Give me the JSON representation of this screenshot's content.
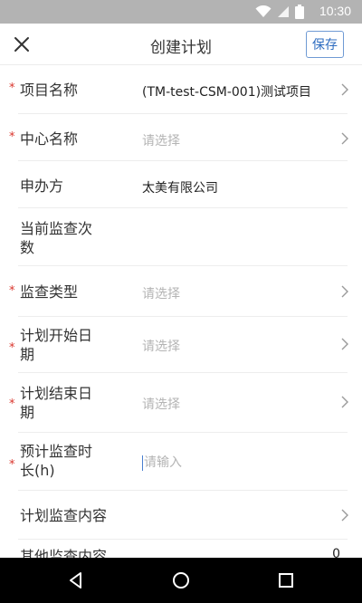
{
  "status_bar": {
    "time": "10:30",
    "icons": [
      "wifi-icon",
      "signal-icon",
      "battery-icon"
    ]
  },
  "app_bar": {
    "title": "创建计划",
    "save_label": "保存",
    "close_icon": "close-icon"
  },
  "form": {
    "rows": [
      {
        "label": "项目名称",
        "required": true,
        "value": "(TM-test-CSM-001)测试项目",
        "placeholder": "",
        "chevron": true
      },
      {
        "label": "中心名称",
        "required": true,
        "value": "",
        "placeholder": "请选择",
        "chevron": true
      },
      {
        "label": "申办方",
        "required": false,
        "value": "太美有限公司",
        "placeholder": "",
        "chevron": false
      },
      {
        "label": "当前监查次数",
        "required": false,
        "value": "",
        "placeholder": "",
        "chevron": false
      },
      {
        "label": "监查类型",
        "required": true,
        "value": "",
        "placeholder": "请选择",
        "chevron": true
      },
      {
        "label": "计划开始日期",
        "required": true,
        "value": "",
        "placeholder": "请选择",
        "chevron": true
      },
      {
        "label": "计划结束日期",
        "required": true,
        "value": "",
        "placeholder": "请选择",
        "chevron": true
      },
      {
        "label": "预计监查时长(h)",
        "required": true,
        "value": "",
        "placeholder": "请输入",
        "chevron": false
      },
      {
        "label": "计划监查内容",
        "required": false,
        "value": "",
        "placeholder": "",
        "chevron": true
      },
      {
        "label": "其他监查内容",
        "required": false,
        "value": "0",
        "placeholder": "",
        "chevron": false
      }
    ]
  },
  "nav_bar": {
    "icons": [
      "back-icon",
      "home-icon",
      "recents-icon"
    ]
  },
  "colors": {
    "status_bar": "#b3b3b3",
    "required_mark": "#d9342b",
    "accent": "#2d6cc0",
    "placeholder": "#b4b4b4"
  }
}
